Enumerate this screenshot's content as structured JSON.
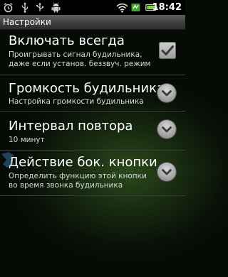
{
  "status_bar": {
    "time": "18:42",
    "icons": [
      "alarm-icon",
      "usb-icon",
      "usb-debug-icon",
      "android-icon",
      "wifi-icon",
      "sync-icon",
      "battery-icon"
    ]
  },
  "title_bar": {
    "title": "Настройки"
  },
  "preferences": [
    {
      "title": "Включать всегда",
      "summary_line1": "Проигрывать сигнал будильника,",
      "summary_line2": "даже если установ. беззвуч. режим",
      "control": "checkbox",
      "checked": true
    },
    {
      "title": "Громкость будильника",
      "summary_line1": "Настройка громкости будильника",
      "control": "chevron-down-icon"
    },
    {
      "title": "Интервал повтора",
      "summary_line1": "10 минут",
      "control": "chevron-down-icon"
    },
    {
      "title": "Действие бок. кнопки",
      "summary_line1": "Определить функцию этой кнопки",
      "summary_line2": "во время звонка будильника",
      "control": "chevron-down-icon"
    }
  ],
  "colors": {
    "background": "#0a1208",
    "accent_glow": "#2c4a1c",
    "title_bar": "#3c3c3c",
    "status_bar": "#000000",
    "divider": "#3e3e3e",
    "summary_text": "#d8d8d8"
  }
}
